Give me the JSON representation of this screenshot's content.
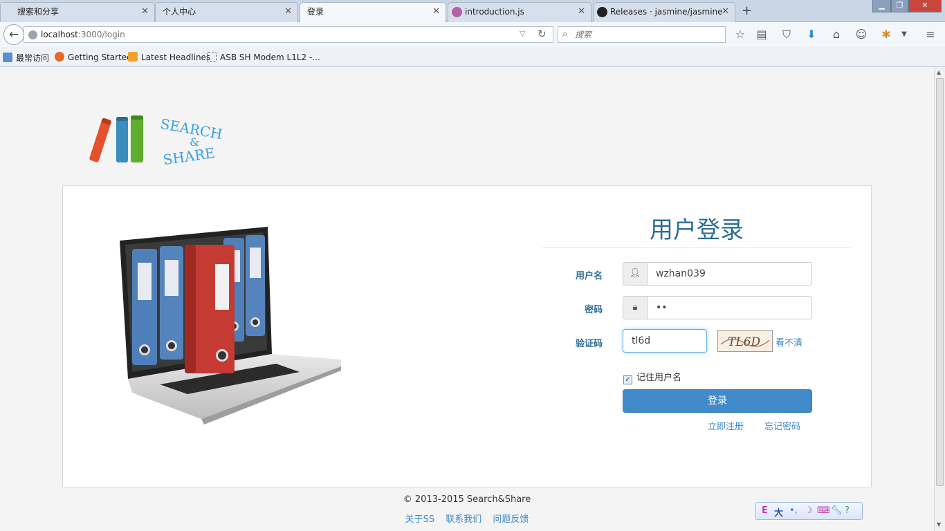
{
  "browser": {
    "tabs": [
      {
        "label": "搜索和分享",
        "active": false
      },
      {
        "label": "个人中心",
        "active": false
      },
      {
        "label": "登录",
        "active": true
      },
      {
        "label": "introduction.js",
        "active": false
      },
      {
        "label": "Releases · jasmine/jasmine",
        "active": false
      }
    ],
    "new_tab": "+",
    "url_host": "localhost",
    "url_path": ":3000/login",
    "search_placeholder": "搜索",
    "bookmarks": [
      "最常访问",
      "Getting Started",
      "Latest Headlines",
      "ASB SH Modem L1L2 -..."
    ]
  },
  "logo": {
    "line1": "SEARCH",
    "amp": "&",
    "line2": "SHARE"
  },
  "login": {
    "title": "用户登录",
    "username_label": "用户名",
    "username_value": "wzhan039",
    "password_label": "密码",
    "password_value": "••",
    "captcha_label": "验证码",
    "captcha_value": "tl6d",
    "captcha_image_text": "TL6D",
    "captcha_refresh": "看不清",
    "remember_label": "记住用户名",
    "remember_checked": true,
    "submit_label": "登录",
    "register_link": "立即注册",
    "forgot_link": "忘记密码"
  },
  "footer": {
    "copyright": "© 2013-2015 Search&Share",
    "links": [
      "关于SS",
      "联系我们",
      "问题反馈"
    ]
  },
  "ime": {
    "items": [
      "E",
      "大"
    ]
  },
  "colors": {
    "accent": "#428bca",
    "title": "#2e6c93",
    "link": "#3b87c7"
  }
}
